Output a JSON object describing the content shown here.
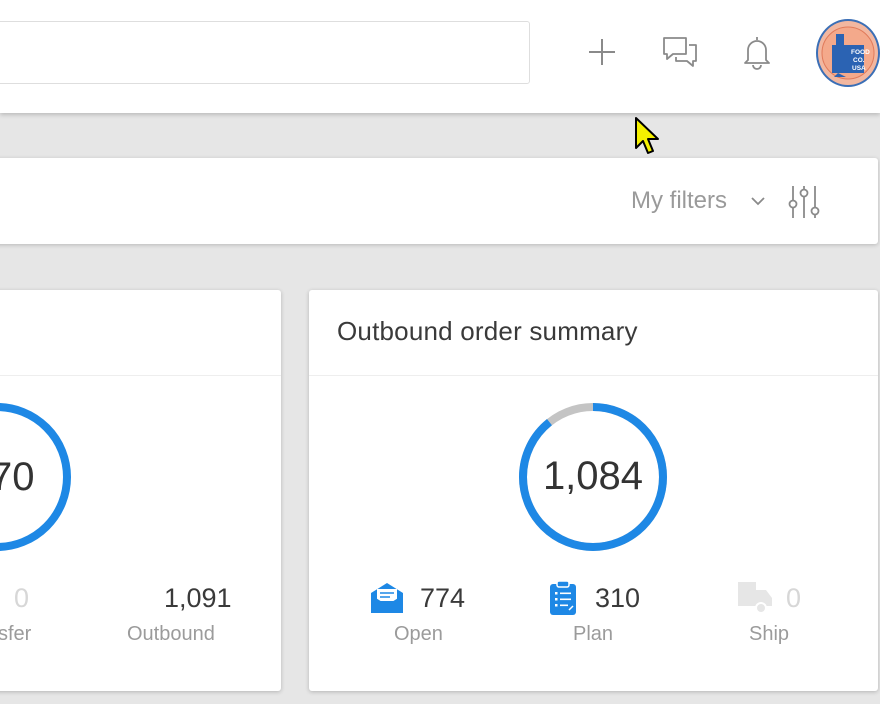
{
  "header": {
    "search": {
      "placeholder": ""
    },
    "icons": [
      "plus-icon",
      "chat-icon",
      "bell-icon"
    ],
    "avatar": {
      "lines": [
        "FOOD",
        "CO.",
        "USA"
      ]
    }
  },
  "filterbar": {
    "my_filters_label": "My filters"
  },
  "left_card": {
    "total_label": "70",
    "stats": [
      {
        "value": "0",
        "label": "sfer"
      },
      {
        "value": "1,091",
        "label": "Outbound"
      }
    ]
  },
  "outbound_card": {
    "title": "Outbound order summary",
    "total_label": "1,084",
    "stats": [
      {
        "icon": "envelope-icon",
        "value": "774",
        "label": "Open"
      },
      {
        "icon": "clipboard-icon",
        "value": "310",
        "label": "Plan"
      },
      {
        "icon": "truck-icon",
        "value": "0",
        "label": "Ship"
      }
    ]
  },
  "colors": {
    "accent": "#1e88e5",
    "ring_track": "#c4c4c4",
    "muted_text": "#9b9b9b",
    "disabled": "#dcdcdc"
  }
}
